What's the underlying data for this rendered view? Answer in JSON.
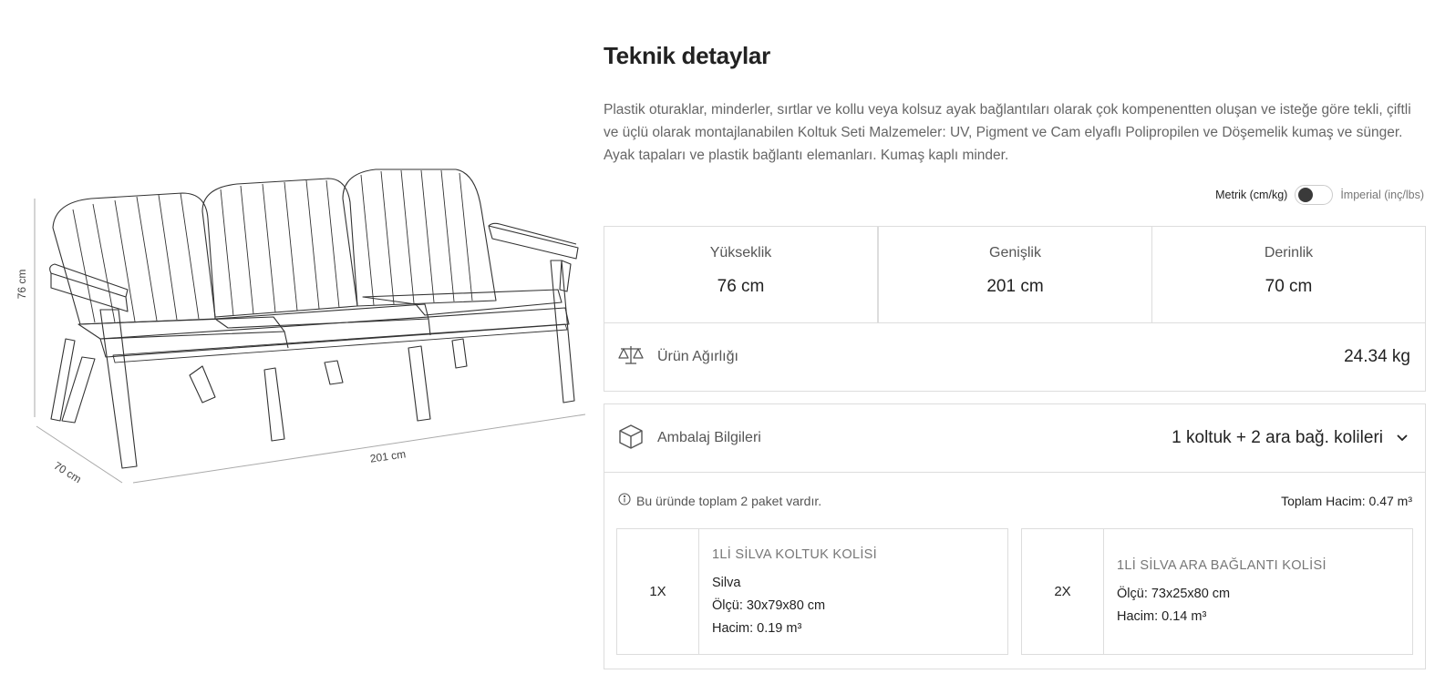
{
  "drawing": {
    "height_label": "76 cm",
    "width_label": "201 cm",
    "depth_label": "70 cm"
  },
  "title": "Teknik detaylar",
  "description": "Plastik oturaklar, minderler, sırtlar ve kollu veya kolsuz ayak bağlantıları olarak çok kompenentten oluşan ve isteğe göre tekli, çiftli ve üçlü olarak montajlanabilen Koltuk Seti Malzemeler: UV, Pigment ve Cam elyaflı Polipropilen ve Döşemelik kumaş ve sünger. Ayak tapaları ve plastik bağlantı elemanları. Kumaş kaplı minder.",
  "units": {
    "metric_label": "Metrik (cm/kg)",
    "imperial_label": "İmperial (inç/lbs)",
    "selected": "metric"
  },
  "dimensions": [
    {
      "label": "Yükseklik",
      "value": "76 cm"
    },
    {
      "label": "Genişlik",
      "value": "201 cm"
    },
    {
      "label": "Derinlik",
      "value": "70 cm"
    }
  ],
  "weight": {
    "icon": "scale-icon",
    "label": "Ürün Ağırlığı",
    "value": "24.34 kg"
  },
  "packaging": {
    "icon": "box-icon",
    "label": "Ambalaj Bilgileri",
    "selected_option": "1 koltuk + 2 ara bağ. kolileri",
    "info_text": "Bu üründe toplam 2 paket vardır.",
    "total_volume": "Toplam Hacim: 0.47 m³",
    "boxes": [
      {
        "qty": "1X",
        "title": "1Lİ SİLVA KOLTUK KOLİSİ",
        "lines": [
          "Silva",
          "Ölçü: 30x79x80 cm",
          "Hacim: 0.19 m³"
        ]
      },
      {
        "qty": "2X",
        "title": "1Lİ SİLVA ARA BAĞLANTI KOLİSİ",
        "lines": [
          "Ölçü: 73x25x80 cm",
          "Hacim: 0.14 m³"
        ]
      }
    ]
  }
}
